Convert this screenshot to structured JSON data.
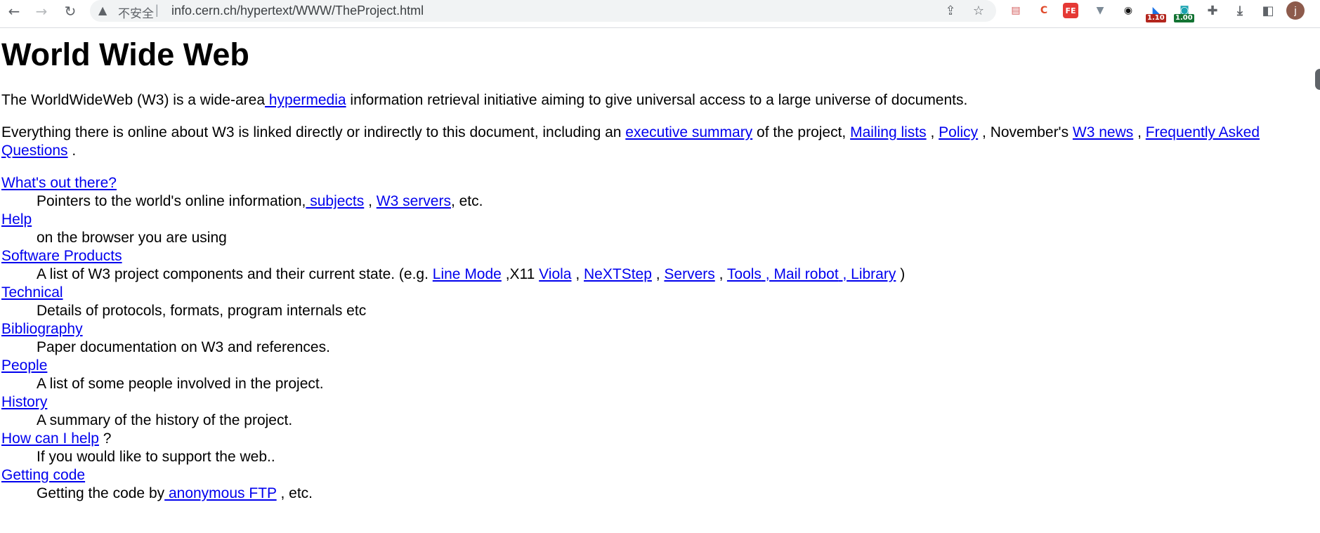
{
  "browser": {
    "insecure_label": "不安全",
    "url": "info.cern.ch/hypertext/WWW/TheProject.html",
    "extension_badges": [
      "1.10",
      "1.00"
    ],
    "profile_initial": "j"
  },
  "page": {
    "title": "World Wide Web",
    "intro": {
      "before": "The WorldWideWeb (W3) is a wide-area",
      "link": " hypermedia",
      "after": " information retrieval initiative aiming to give universal access to a large universe of documents."
    },
    "everything": {
      "t1": "Everything there is online about W3 is linked directly or indirectly to this document, including an ",
      "exec_summary": "executive summary",
      "t2": " of the project, ",
      "mailing_lists": "Mailing lists",
      "t3": " , ",
      "policy": "Policy",
      "t4": " , November's ",
      "w3_news": "W3 news",
      "t5": " , ",
      "faq": "Frequently Asked Questions",
      "t6": " ."
    },
    "sections": {
      "whats_out": {
        "term": "What's out there?",
        "d1": "Pointers to the world's online information,",
        "l1": " subjects",
        "d2": " , ",
        "l2": "W3 servers",
        "d3": ", etc."
      },
      "help": {
        "term": "Help",
        "desc": "on the browser you are using"
      },
      "software": {
        "term": "Software Products",
        "d1": "A list of W3 project components and their current state. (e.g. ",
        "line_mode": "Line Mode",
        "d2": " ,X11 ",
        "viola": "Viola",
        "d3": " , ",
        "nextstep": "NeXTStep",
        "d4": " , ",
        "servers": "Servers",
        "d5": " , ",
        "tools": "Tools",
        "d6": " ,",
        "mail_robot": " Mail robot",
        "d7": " ,",
        "library": " Library",
        "d8": " )"
      },
      "technical": {
        "term": "Technical",
        "desc": "Details of protocols, formats, program internals etc"
      },
      "bibliography": {
        "term": "Bibliography",
        "desc": "Paper documentation on W3 and references."
      },
      "people": {
        "term": "People",
        "desc": "A list of some people involved in the project."
      },
      "history": {
        "term": "History",
        "desc": "A summary of the history of the project."
      },
      "how_help": {
        "term": "How can I help",
        "term_after": " ?",
        "desc": "If you would like to support the web.."
      },
      "getting_code": {
        "term": "Getting code",
        "d1": "Getting the code by",
        "ftp": " anonymous FTP",
        "d2": " , etc."
      }
    }
  }
}
